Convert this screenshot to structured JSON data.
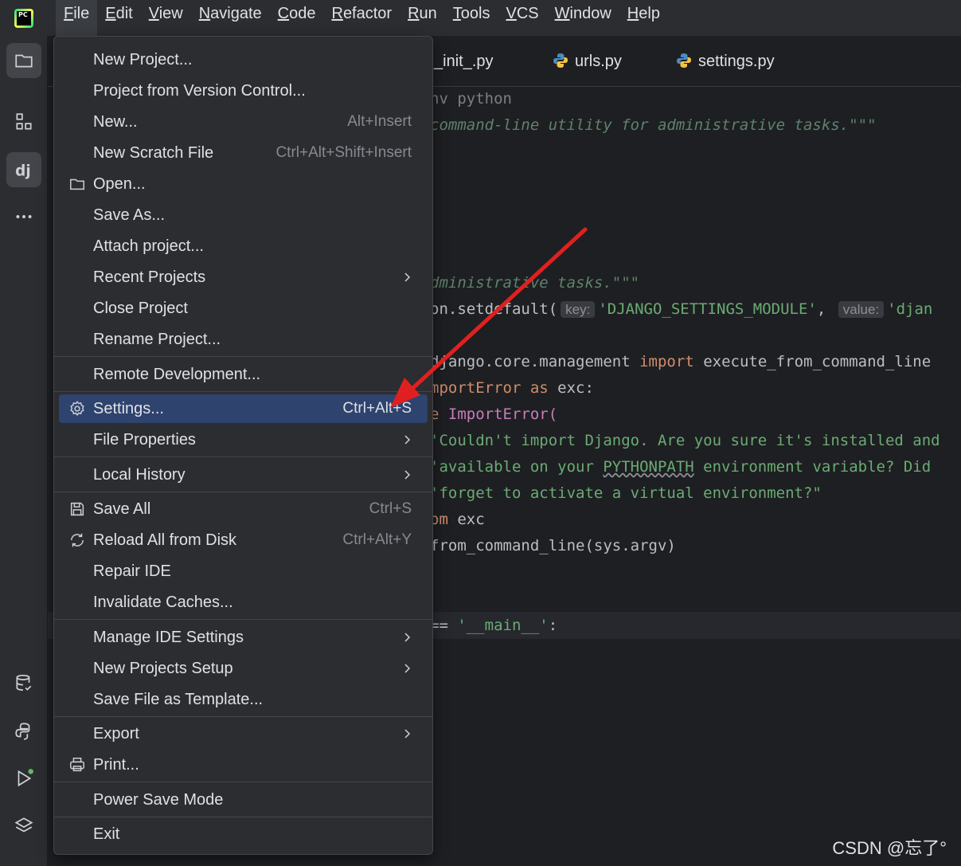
{
  "menubar": {
    "logo": "PC",
    "items": [
      "File",
      "Edit",
      "View",
      "Navigate",
      "Code",
      "Refactor",
      "Run",
      "Tools",
      "VCS",
      "Window",
      "Help"
    ]
  },
  "tabs": [
    {
      "label": "_init_.py"
    },
    {
      "label": "urls.py",
      "icon": "python-file-icon"
    },
    {
      "label": "settings.py",
      "icon": "python-file-icon"
    }
  ],
  "code": {
    "line1": "nv python",
    "line2": "command-line utility for administrative tasks.\"\"\"",
    "line3": "dministrative tasks.\"\"\"",
    "line4_a": "on.setdefault(",
    "line4_key": "key:",
    "line4_b": "'DJANGO_SETTINGS_MODULE'",
    "line4_c": ",",
    "line4_val": "value:",
    "line4_d": "'djan",
    "line5_a": "django.core.management ",
    "line5_kw": "import",
    "line5_b": " execute_from_command_line",
    "line6_a": "mportError ",
    "line6_kw": "as",
    "line6_b": " exc:",
    "line7_a": "e ",
    "line7_b": "ImportError(",
    "line8": "'Couldn't import Django. Are you sure it's installed and",
    "line9_a": "'available on your ",
    "line9_b": "PYTHONPATH",
    "line9_c": " environment variable? Did",
    "line10": "'forget to activate a virtual environment?\"",
    "line11_a": "om",
    "line11_b": " exc",
    "line12": "from_command_line(sys.argv)",
    "line13_a": "== ",
    "line13_b": "'__main__'",
    "line13_c": ":"
  },
  "file_menu": {
    "items": [
      {
        "label": "New Project...",
        "shortcut": ""
      },
      {
        "label": "Project from Version Control...",
        "shortcut": ""
      },
      {
        "label": "New...",
        "shortcut": "Alt+Insert"
      },
      {
        "label": "New Scratch File",
        "shortcut": "Ctrl+Alt+Shift+Insert"
      },
      {
        "label": "Open...",
        "shortcut": "",
        "icon": "folder-icon"
      },
      {
        "label": "Save As...",
        "shortcut": ""
      },
      {
        "label": "Attach project...",
        "shortcut": ""
      },
      {
        "label": "Recent Projects",
        "submenu": true
      },
      {
        "label": "Close Project",
        "shortcut": ""
      },
      {
        "label": "Rename Project...",
        "shortcut": ""
      },
      {
        "label": "Remote Development...",
        "shortcut": ""
      },
      {
        "label": "Settings...",
        "shortcut": "Ctrl+Alt+S",
        "icon": "gear-icon",
        "selected": true
      },
      {
        "label": "File Properties",
        "submenu": true
      },
      {
        "label": "Local History",
        "submenu": true
      },
      {
        "label": "Save All",
        "shortcut": "Ctrl+S",
        "icon": "save-icon"
      },
      {
        "label": "Reload All from Disk",
        "shortcut": "Ctrl+Alt+Y",
        "icon": "reload-icon"
      },
      {
        "label": "Repair IDE",
        "shortcut": ""
      },
      {
        "label": "Invalidate Caches...",
        "shortcut": ""
      },
      {
        "label": "Manage IDE Settings",
        "submenu": true
      },
      {
        "label": "New Projects Setup",
        "submenu": true
      },
      {
        "label": "Save File as Template...",
        "shortcut": ""
      },
      {
        "label": "Export",
        "submenu": true
      },
      {
        "label": "Print...",
        "shortcut": "",
        "icon": "print-icon"
      },
      {
        "label": "Power Save Mode",
        "shortcut": ""
      },
      {
        "label": "Exit",
        "shortcut": ""
      }
    ]
  },
  "watermark": "CSDN @忘了°",
  "colors": {
    "selection": "#2e436e",
    "annotation_arrow": "#e02020"
  }
}
